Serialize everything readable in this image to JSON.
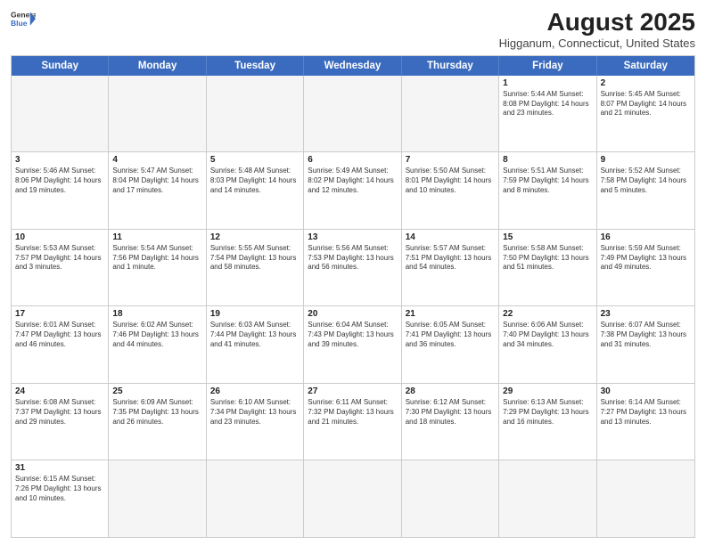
{
  "header": {
    "logo_line1": "General",
    "logo_line2": "Blue",
    "month_title": "August 2025",
    "location": "Higganum, Connecticut, United States"
  },
  "days_of_week": [
    "Sunday",
    "Monday",
    "Tuesday",
    "Wednesday",
    "Thursday",
    "Friday",
    "Saturday"
  ],
  "weeks": [
    [
      {
        "day": "",
        "text": ""
      },
      {
        "day": "",
        "text": ""
      },
      {
        "day": "",
        "text": ""
      },
      {
        "day": "",
        "text": ""
      },
      {
        "day": "",
        "text": ""
      },
      {
        "day": "1",
        "text": "Sunrise: 5:44 AM\nSunset: 8:08 PM\nDaylight: 14 hours and 23 minutes."
      },
      {
        "day": "2",
        "text": "Sunrise: 5:45 AM\nSunset: 8:07 PM\nDaylight: 14 hours and 21 minutes."
      }
    ],
    [
      {
        "day": "3",
        "text": "Sunrise: 5:46 AM\nSunset: 8:06 PM\nDaylight: 14 hours and 19 minutes."
      },
      {
        "day": "4",
        "text": "Sunrise: 5:47 AM\nSunset: 8:04 PM\nDaylight: 14 hours and 17 minutes."
      },
      {
        "day": "5",
        "text": "Sunrise: 5:48 AM\nSunset: 8:03 PM\nDaylight: 14 hours and 14 minutes."
      },
      {
        "day": "6",
        "text": "Sunrise: 5:49 AM\nSunset: 8:02 PM\nDaylight: 14 hours and 12 minutes."
      },
      {
        "day": "7",
        "text": "Sunrise: 5:50 AM\nSunset: 8:01 PM\nDaylight: 14 hours and 10 minutes."
      },
      {
        "day": "8",
        "text": "Sunrise: 5:51 AM\nSunset: 7:59 PM\nDaylight: 14 hours and 8 minutes."
      },
      {
        "day": "9",
        "text": "Sunrise: 5:52 AM\nSunset: 7:58 PM\nDaylight: 14 hours and 5 minutes."
      }
    ],
    [
      {
        "day": "10",
        "text": "Sunrise: 5:53 AM\nSunset: 7:57 PM\nDaylight: 14 hours and 3 minutes."
      },
      {
        "day": "11",
        "text": "Sunrise: 5:54 AM\nSunset: 7:56 PM\nDaylight: 14 hours and 1 minute."
      },
      {
        "day": "12",
        "text": "Sunrise: 5:55 AM\nSunset: 7:54 PM\nDaylight: 13 hours and 58 minutes."
      },
      {
        "day": "13",
        "text": "Sunrise: 5:56 AM\nSunset: 7:53 PM\nDaylight: 13 hours and 56 minutes."
      },
      {
        "day": "14",
        "text": "Sunrise: 5:57 AM\nSunset: 7:51 PM\nDaylight: 13 hours and 54 minutes."
      },
      {
        "day": "15",
        "text": "Sunrise: 5:58 AM\nSunset: 7:50 PM\nDaylight: 13 hours and 51 minutes."
      },
      {
        "day": "16",
        "text": "Sunrise: 5:59 AM\nSunset: 7:49 PM\nDaylight: 13 hours and 49 minutes."
      }
    ],
    [
      {
        "day": "17",
        "text": "Sunrise: 6:01 AM\nSunset: 7:47 PM\nDaylight: 13 hours and 46 minutes."
      },
      {
        "day": "18",
        "text": "Sunrise: 6:02 AM\nSunset: 7:46 PM\nDaylight: 13 hours and 44 minutes."
      },
      {
        "day": "19",
        "text": "Sunrise: 6:03 AM\nSunset: 7:44 PM\nDaylight: 13 hours and 41 minutes."
      },
      {
        "day": "20",
        "text": "Sunrise: 6:04 AM\nSunset: 7:43 PM\nDaylight: 13 hours and 39 minutes."
      },
      {
        "day": "21",
        "text": "Sunrise: 6:05 AM\nSunset: 7:41 PM\nDaylight: 13 hours and 36 minutes."
      },
      {
        "day": "22",
        "text": "Sunrise: 6:06 AM\nSunset: 7:40 PM\nDaylight: 13 hours and 34 minutes."
      },
      {
        "day": "23",
        "text": "Sunrise: 6:07 AM\nSunset: 7:38 PM\nDaylight: 13 hours and 31 minutes."
      }
    ],
    [
      {
        "day": "24",
        "text": "Sunrise: 6:08 AM\nSunset: 7:37 PM\nDaylight: 13 hours and 29 minutes."
      },
      {
        "day": "25",
        "text": "Sunrise: 6:09 AM\nSunset: 7:35 PM\nDaylight: 13 hours and 26 minutes."
      },
      {
        "day": "26",
        "text": "Sunrise: 6:10 AM\nSunset: 7:34 PM\nDaylight: 13 hours and 23 minutes."
      },
      {
        "day": "27",
        "text": "Sunrise: 6:11 AM\nSunset: 7:32 PM\nDaylight: 13 hours and 21 minutes."
      },
      {
        "day": "28",
        "text": "Sunrise: 6:12 AM\nSunset: 7:30 PM\nDaylight: 13 hours and 18 minutes."
      },
      {
        "day": "29",
        "text": "Sunrise: 6:13 AM\nSunset: 7:29 PM\nDaylight: 13 hours and 16 minutes."
      },
      {
        "day": "30",
        "text": "Sunrise: 6:14 AM\nSunset: 7:27 PM\nDaylight: 13 hours and 13 minutes."
      }
    ],
    [
      {
        "day": "31",
        "text": "Sunrise: 6:15 AM\nSunset: 7:26 PM\nDaylight: 13 hours and 10 minutes."
      },
      {
        "day": "",
        "text": ""
      },
      {
        "day": "",
        "text": ""
      },
      {
        "day": "",
        "text": ""
      },
      {
        "day": "",
        "text": ""
      },
      {
        "day": "",
        "text": ""
      },
      {
        "day": "",
        "text": ""
      }
    ]
  ]
}
